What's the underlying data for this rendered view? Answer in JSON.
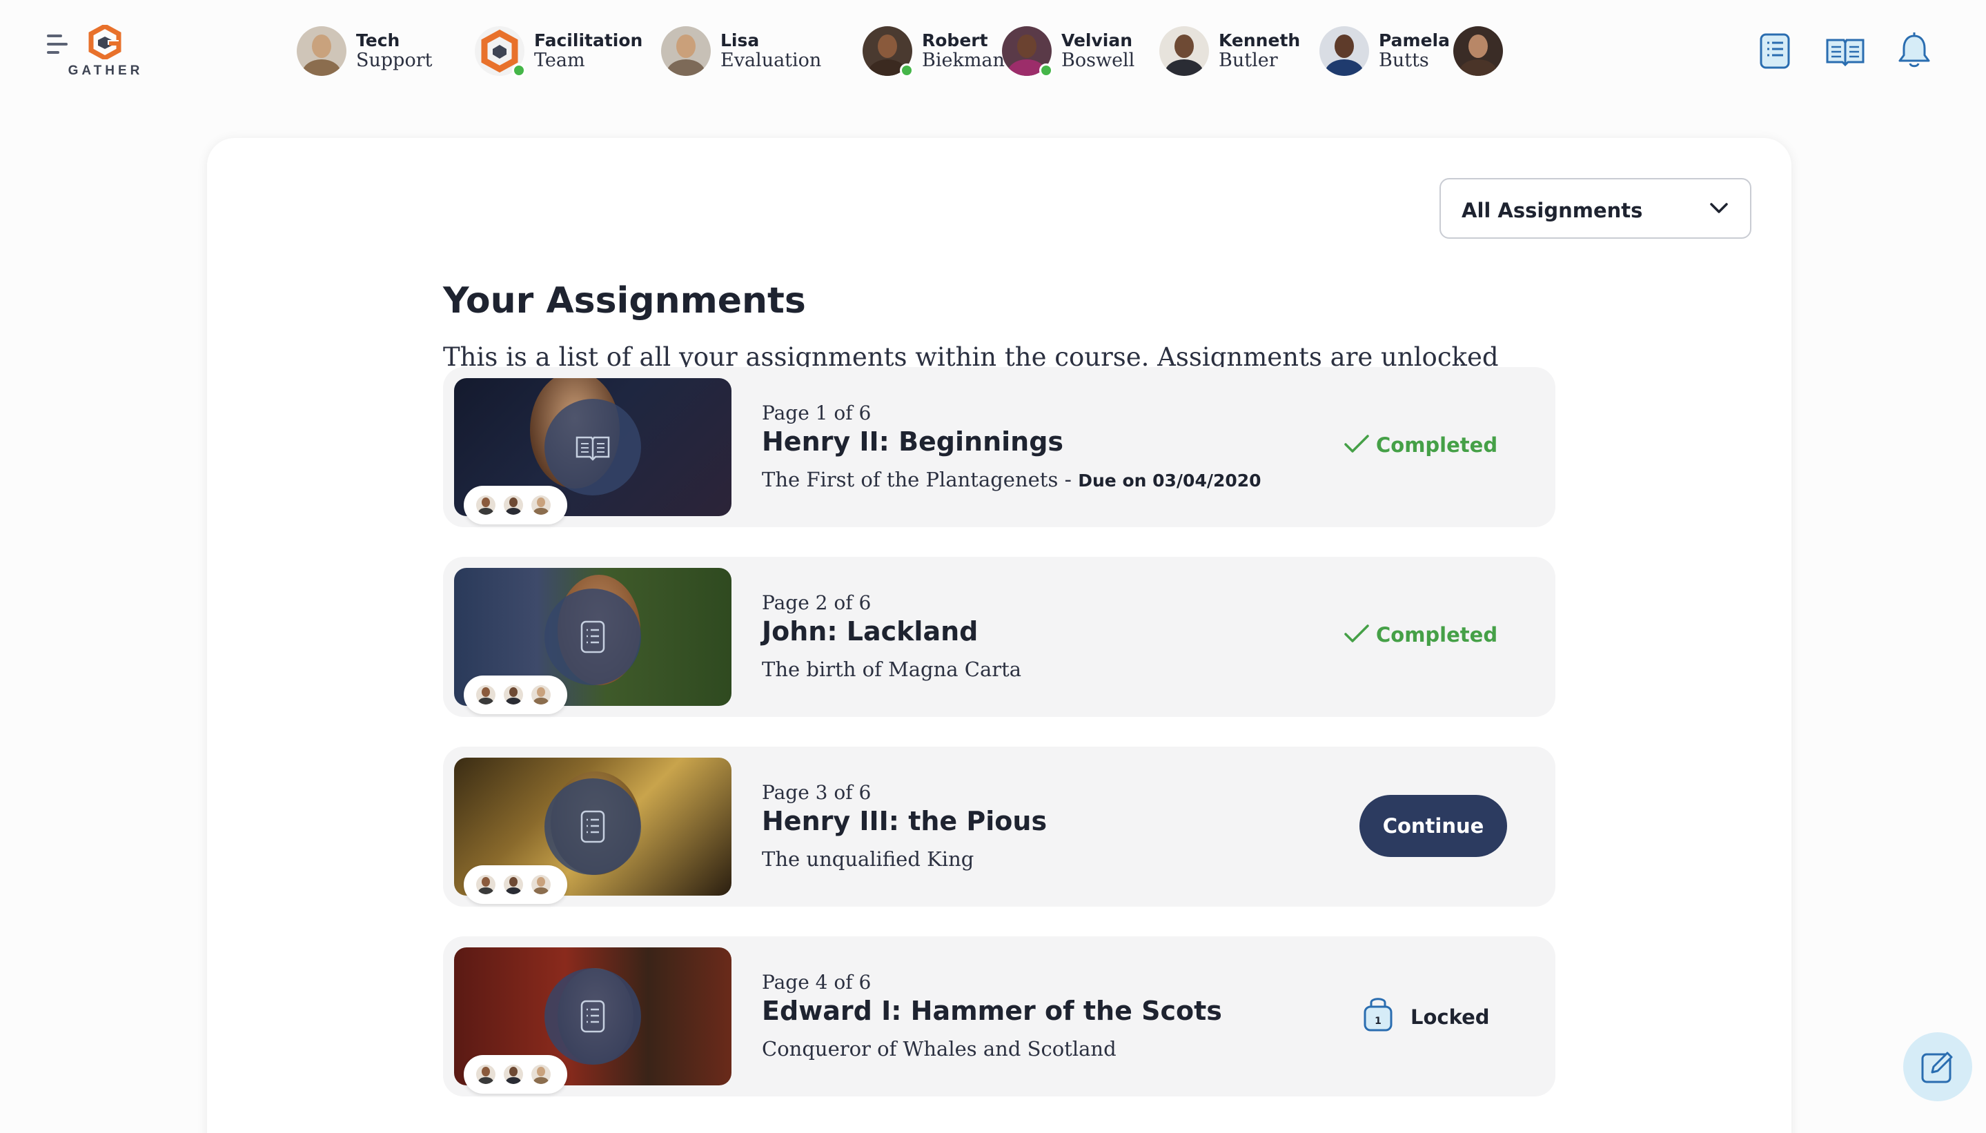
{
  "app": {
    "logo_text": "GATHER"
  },
  "people": [
    {
      "first": "Tech",
      "last": "Support",
      "online": false,
      "skin": "#c9a27d",
      "shirt": "#8b6d4e",
      "bg": "#cfc5b8"
    },
    {
      "first": "Facilitation",
      "last": "Team",
      "online": true,
      "logo": true
    },
    {
      "first": "Lisa",
      "last": "Evaluation",
      "online": false,
      "skin": "#caa07a",
      "shirt": "#7d6a58",
      "bg": "#c7c0b6"
    },
    {
      "first": "Robert",
      "last": "Biekman",
      "online": true,
      "skin": "#8a5a3c",
      "shirt": "#3b2a20",
      "bg": "#4a3a30"
    },
    {
      "first": "Velvian",
      "last": "Boswell",
      "online": true,
      "skin": "#6b4230",
      "shirt": "#9c2d6a",
      "bg": "#5a3a48"
    },
    {
      "first": "Kenneth",
      "last": "Butler",
      "online": false,
      "skin": "#6e4a34",
      "shirt": "#2a2c34",
      "bg": "#e7e3dc"
    },
    {
      "first": "Pamela",
      "last": "Butts",
      "online": false,
      "skin": "#5e3b2a",
      "shirt": "#1f3b6e",
      "bg": "#d9dde4"
    },
    {
      "first": "",
      "last": "",
      "online": false,
      "skin": "#b88767",
      "shirt": "#4a3428",
      "bg": "#3a2c26"
    }
  ],
  "top_icons": [
    "assignments-list-icon",
    "reader-book-icon",
    "notification-bell-icon"
  ],
  "filter": {
    "label": "All Assignments"
  },
  "page": {
    "title": "Your Assignments",
    "intro": "This is a list of all your assignments within the course. Assignments are unlocked once you complete the previous assignment, and you can revisit old assignments at any time."
  },
  "assignments": [
    {
      "page": "Page 1 of 6",
      "title": "Henry II: Beginnings",
      "subtitle": "The First of the Plantagenets",
      "separator": " - ",
      "due": "Due on 03/04/2020",
      "status": "Completed",
      "badge_icon": "book-icon"
    },
    {
      "page": "Page 2 of 6",
      "title": "John: Lackland",
      "subtitle": "The birth of Magna Carta",
      "separator": "",
      "due": "",
      "status": "Completed",
      "badge_icon": "list-icon"
    },
    {
      "page": "Page 3 of 6",
      "title": "Henry III: the Pious",
      "subtitle": "The unqualified King",
      "separator": "",
      "due": "",
      "status": "Continue",
      "badge_icon": "list-icon"
    },
    {
      "page": "Page 4 of 6",
      "title": "Edward I: Hammer of the Scots",
      "subtitle": "Conqueror of Whales and Scotland",
      "separator": "",
      "due": "",
      "status": "Locked",
      "badge_icon": "list-icon"
    }
  ],
  "colors": {
    "completed": "#45a047",
    "primary": "#2c3b60",
    "accent": "#e8712b"
  }
}
